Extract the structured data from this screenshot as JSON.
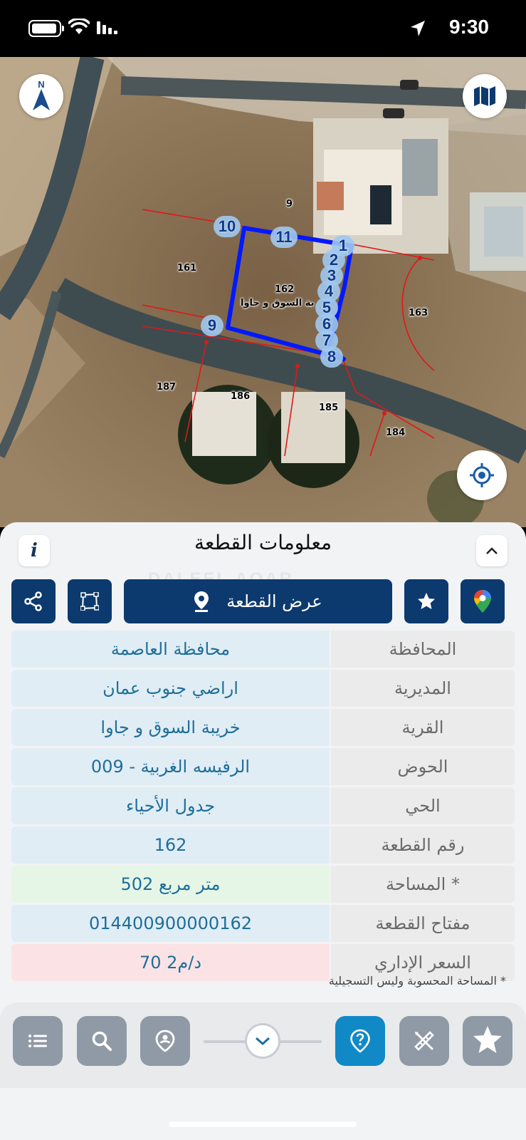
{
  "status_bar": {
    "time": "9:30"
  },
  "map": {
    "parcel_numbers": {
      "p9": "9",
      "p161": "161",
      "p162": "162",
      "p163": "163",
      "p184": "184",
      "p185": "185",
      "p186": "186",
      "p187": "187"
    },
    "village_overlay_label": "بة السوق  و جاوا",
    "vertices": [
      "1",
      "2",
      "3",
      "4",
      "5",
      "6",
      "7",
      "8",
      "9",
      "10",
      "11"
    ],
    "compass_letter": "N"
  },
  "sheet": {
    "title": "معلومات القطعة",
    "info_label": "i",
    "watermark": "DALEEL AQAR",
    "show_parcel_label": "عرض القطعة",
    "rows": [
      {
        "key": "المحافظة",
        "value": "محافظة العاصمة"
      },
      {
        "key": "المديرية",
        "value": "اراضي جنوب عمان"
      },
      {
        "key": "القرية",
        "value": "خريبة السوق  و جاوا"
      },
      {
        "key": "الحوض",
        "value": "الرفيسه الغربية - 009"
      },
      {
        "key": "الحي",
        "value": "جدول الأحياء"
      },
      {
        "key": "رقم القطعة",
        "value": "162"
      },
      {
        "key": "المساحة *",
        "value": "502  متر مربع"
      },
      {
        "key": "مفتاح القطعة",
        "value": "014400900000162"
      },
      {
        "key": "السعر الإداري",
        "value": "70 د/م2"
      }
    ],
    "footnote": "* المساحة المحسوبة وليس التسجيلية"
  },
  "colors": {
    "primary": "#0d3a6e",
    "value_text": "#1f6e9a",
    "active_tool": "#1189c7",
    "parcel_outline": "#0019ff"
  },
  "icons": [
    "battery-icon",
    "wifi-icon",
    "signal-icon",
    "location-arrow-icon",
    "compass-icon",
    "map-layers-icon",
    "my-location-icon",
    "info-icon",
    "chevron-up-icon",
    "share-icon",
    "polygon-icon",
    "pin-icon",
    "star-icon",
    "google-maps-icon",
    "list-icon",
    "search-icon",
    "person-pin-icon",
    "chevron-down-icon",
    "help-pin-icon",
    "ruler-pencil-icon",
    "badge-star-icon"
  ]
}
